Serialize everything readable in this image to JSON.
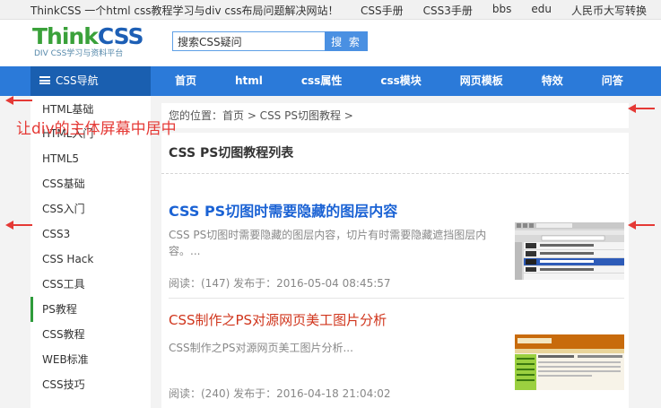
{
  "topbar": {
    "slogan": "ThinkCSS 一个html css教程学习与div css布局问题解决网站！",
    "links": [
      "CSS手册",
      "CSS3手册",
      "bbs",
      "edu",
      "人民币大写转换"
    ]
  },
  "header": {
    "logo_main": "Think",
    "logo_css": "CSS",
    "logo_sub": "DIV CSS学习与资料平台",
    "search_value": "搜索CSS疑问",
    "search_button": "搜 索"
  },
  "nav": {
    "category_label": "CSS导航",
    "items": [
      "首页",
      "html",
      "css属性",
      "css模块",
      "网页模板",
      "特效",
      "问答"
    ]
  },
  "sidebar": {
    "items": [
      "HTML基础",
      "HTML入门",
      "HTML5",
      "CSS基础",
      "CSS入门",
      "CSS3",
      "CSS Hack",
      "CSS工具",
      "PS教程",
      "CSS教程",
      "WEB标准",
      "CSS技巧"
    ],
    "active_index": 8
  },
  "breadcrumb": {
    "text": "您的位置：首页 > CSS PS切图教程 >"
  },
  "main": {
    "list_title": "CSS  PS切图教程列表",
    "articles": [
      {
        "title": "CSS PS切图时需要隐藏的图层内容",
        "desc": "CSS PS切图时需要隐藏的图层内容，切片有时需要隐藏遮挡图层内容。...",
        "meta": "阅读：(147)    发布于：2016-05-04 08:45:57"
      },
      {
        "title": "CSS制作之PS对源网页美工图片分析",
        "desc": "CSS制作之PS对源网页美工图片分析...",
        "meta": "阅读：(240)    发布于：2016-04-18 21:04:02"
      }
    ]
  },
  "annotation": {
    "text": "让div的主体屏幕中居中",
    "color": "#e53935"
  },
  "colors": {
    "nav_blue": "#2b7ad9",
    "nav_dark": "#1a5fb0",
    "title_blue": "#1a62d4",
    "title_red": "#d0351c",
    "active_green": "#2e9b3b"
  }
}
